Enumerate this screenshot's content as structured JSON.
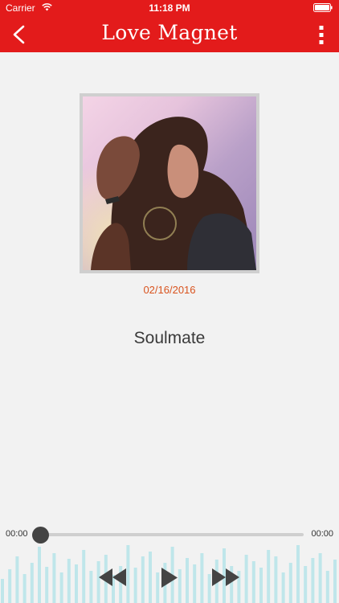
{
  "status_bar": {
    "carrier": "Carrier",
    "time": "11:18 PM",
    "wifi_icon": "wifi-icon",
    "battery_icon": "battery-icon"
  },
  "nav": {
    "title": "Love Magnet",
    "back_icon": "chevron-left-icon",
    "more_icon": "more-vertical-icon"
  },
  "track": {
    "date": "02/16/2016",
    "title": "Soulmate",
    "artwork_icon": "album-artwork"
  },
  "player": {
    "elapsed": "00:00",
    "duration": "00:00",
    "progress": 0,
    "rewind_icon": "rewind-icon",
    "play_icon": "play-icon",
    "forward_icon": "fast-forward-icon"
  },
  "colors": {
    "accent": "#e31b1b",
    "date": "#d9531e",
    "background": "#f2f2f2",
    "visualizer": "#bfe6ea"
  }
}
